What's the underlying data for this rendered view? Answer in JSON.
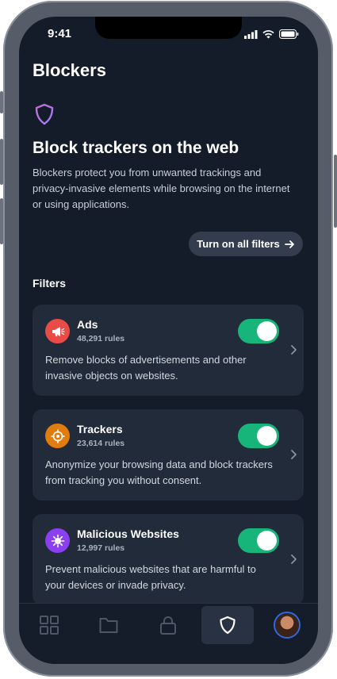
{
  "status_bar": {
    "time": "9:41"
  },
  "page": {
    "title": "Blockers"
  },
  "hero": {
    "icon": "shield-icon",
    "title": "Block trackers on the web",
    "description": "Blockers protect you from unwanted trackings and privacy-invasive elements while browsing on the internet or using applications."
  },
  "cta": {
    "label": "Turn on all filters",
    "icon": "arrow-right-icon"
  },
  "filters_section": {
    "title": "Filters",
    "items": [
      {
        "name": "Ads",
        "rules": "48,291 rules",
        "description": "Remove blocks of advertisements and other invasive objects on websites.",
        "icon": "megaphone-icon",
        "color": "#e94b47",
        "enabled": true
      },
      {
        "name": "Trackers",
        "rules": "23,614 rules",
        "description": "Anonymize your browsing data and block trackers from tracking you without consent.",
        "icon": "crosshair-icon",
        "color": "#e07d0e",
        "enabled": true
      },
      {
        "name": "Malicious Websites",
        "rules": "12,997 rules",
        "description": "Prevent malicious websites that are harmful to your devices or invade privacy.",
        "icon": "virus-icon",
        "color": "#8a3ff0",
        "enabled": true
      }
    ]
  },
  "tabbar": {
    "items": [
      {
        "icon": "grid-icon",
        "active": false
      },
      {
        "icon": "folder-icon",
        "active": false
      },
      {
        "icon": "lock-icon",
        "active": false
      },
      {
        "icon": "shield-icon",
        "active": true
      },
      {
        "icon": "avatar",
        "active": false
      }
    ]
  },
  "colors": {
    "accent_toggle": "#18b57a",
    "background": "#141b29",
    "card": "#222b3a"
  }
}
